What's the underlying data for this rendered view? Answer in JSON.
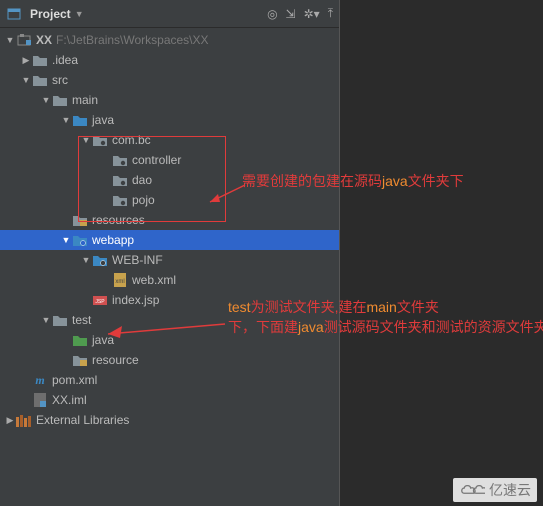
{
  "toolbar": {
    "title": "Project",
    "icons": [
      "target",
      "collapse",
      "settings",
      "hide"
    ]
  },
  "root": {
    "name": "XX",
    "path": "F:\\JetBrains\\Workspaces\\XX"
  },
  "tree": {
    "idea": ".idea",
    "src": "src",
    "main": "main",
    "java": "java",
    "pkg_root": "com.bc",
    "controller": "controller",
    "dao": "dao",
    "pojo": "pojo",
    "resources": "resources",
    "webapp": "webapp",
    "webinf": "WEB-INF",
    "webxml": "web.xml",
    "indexjsp": "index.jsp",
    "test": "test",
    "test_java": "java",
    "test_resource": "resource",
    "pom": "pom.xml",
    "iml": "XX.iml",
    "ext_lib": "External Libraries"
  },
  "annotations": {
    "a1_pre": "需要创建的包建在源码",
    "a1_hl": "java",
    "a1_post": "文件夹下",
    "a2_l1_pre": "test",
    "a2_l1_mid": "为测试文件夹,建在",
    "a2_l1_hl": "main",
    "a2_l1_post": "文件夹",
    "a2_l2_pre": "下，下面建",
    "a2_l2_hl": "java",
    "a2_l2_post": "测试源码文件夹和测试的资源文件夹"
  },
  "watermark": "亿速云"
}
